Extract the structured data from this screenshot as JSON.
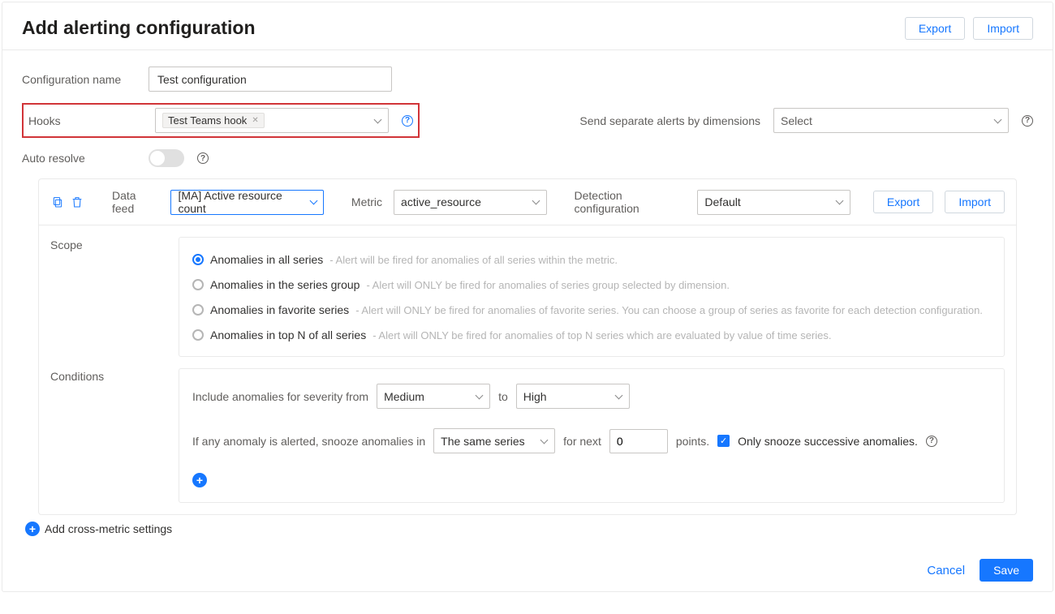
{
  "header": {
    "title": "Add alerting configuration",
    "export_label": "Export",
    "import_label": "Import"
  },
  "form": {
    "config_name_label": "Configuration name",
    "config_name_value": "Test configuration",
    "hooks_label": "Hooks",
    "hooks_tag": "Test Teams hook",
    "separate_alerts_label": "Send separate alerts by dimensions",
    "separate_alerts_placeholder": "Select",
    "auto_resolve_label": "Auto resolve"
  },
  "metricHeader": {
    "data_feed_label": "Data feed",
    "data_feed_value": "[MA] Active resource count",
    "metric_label": "Metric",
    "metric_value": "active_resource",
    "detect_conf_label": "Detection configuration",
    "detect_conf_value": "Default",
    "export_label": "Export",
    "import_label": "Import"
  },
  "scope": {
    "label": "Scope",
    "options": [
      {
        "label": "Anomalies in all series",
        "hint": "- Alert will be fired for anomalies of all series within the metric.",
        "checked": true
      },
      {
        "label": "Anomalies in the series group",
        "hint": "- Alert will ONLY be fired for anomalies of series group selected by dimension.",
        "checked": false
      },
      {
        "label": "Anomalies in favorite series",
        "hint": "- Alert will ONLY be fired for anomalies of favorite series. You can choose a group of series as favorite for each detection configuration.",
        "checked": false
      },
      {
        "label": "Anomalies in top N of all series",
        "hint": "- Alert will ONLY be fired for anomalies of top N series which are evaluated by value of time series.",
        "checked": false
      }
    ]
  },
  "conditions": {
    "label": "Conditions",
    "severity_text": "Include anomalies for severity from",
    "severity_min": "Medium",
    "severity_to": "to",
    "severity_max": "High",
    "snooze_text1": "If any anomaly is alerted, snooze anomalies in",
    "snooze_scope": "The same series",
    "snooze_text2": "for next",
    "snooze_value": "0",
    "snooze_text3": "points.",
    "snooze_checkbox_label": "Only snooze successive anomalies."
  },
  "addCross": "Add cross-metric settings",
  "footer": {
    "cancel": "Cancel",
    "save": "Save"
  }
}
